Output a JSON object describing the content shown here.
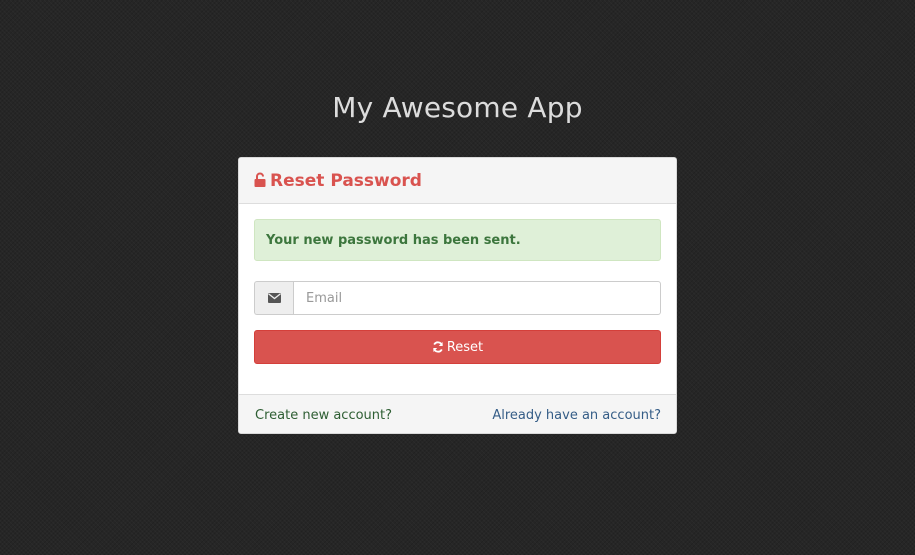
{
  "app": {
    "title": "My Awesome App"
  },
  "panel": {
    "heading": "Reset Password",
    "heading_icon": "unlock-icon"
  },
  "alert": {
    "message": "Your new password has been sent."
  },
  "email": {
    "placeholder": "Email",
    "value": "",
    "icon": "envelope-icon"
  },
  "reset_button": {
    "label": "Reset",
    "icon": "refresh-icon"
  },
  "footer": {
    "create_account": "Create new account?",
    "have_account": "Already have an account?"
  },
  "colors": {
    "danger": "#d9534f",
    "success_bg": "#dff0d8",
    "success_text": "#3c763d",
    "background": "#262626"
  }
}
